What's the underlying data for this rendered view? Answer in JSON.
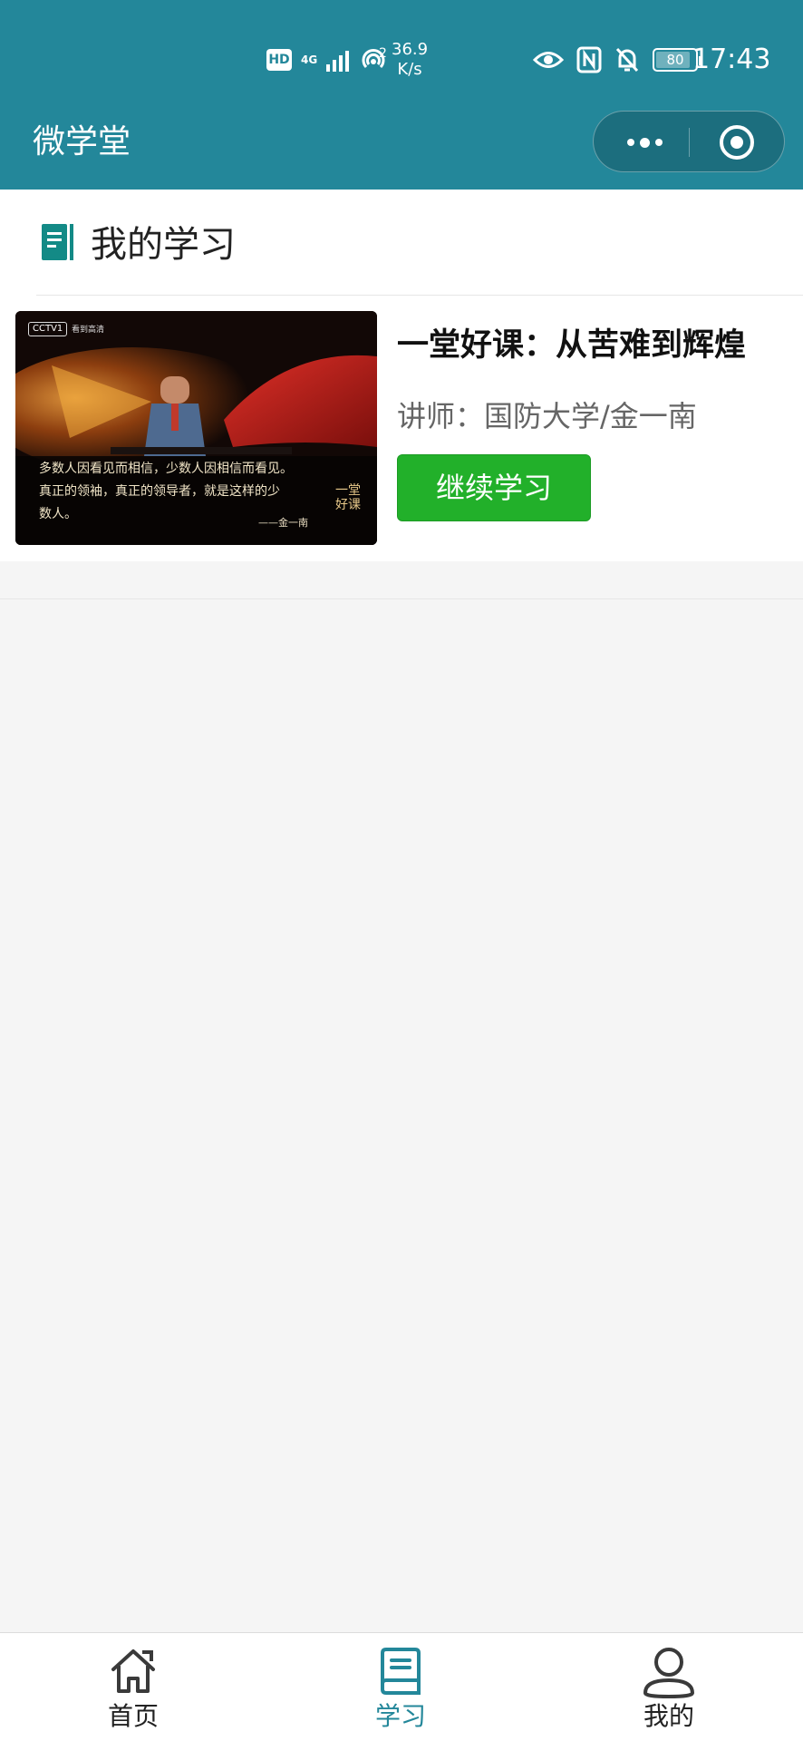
{
  "status_bar": {
    "hd": "HD",
    "network": "4G",
    "hotspot_count": "2",
    "speed_value": "36.9",
    "speed_unit": "K/s",
    "battery": "80",
    "time": "17:43"
  },
  "nav": {
    "title": "微学堂",
    "more_icon": "more-dots-icon",
    "close_icon": "target-circle-icon"
  },
  "section": {
    "title": "我的学习",
    "icon": "book-icon"
  },
  "course": {
    "title": "一堂好课：从苦难到辉煌",
    "teacher": "讲师：国防大学/金一南",
    "button": "继续学习",
    "thumbnail": {
      "logo": "CCTV1",
      "logo_sub": "看到高清",
      "quote_line1": "多数人因看见而相信，少数人因相信而看见。",
      "quote_line2": "真正的领袖，真正的领导者，就是这样的少",
      "quote_line3": "数人。",
      "signature": "——金一南",
      "mark_line1": "一堂",
      "mark_line2": "好课"
    }
  },
  "tabbar": {
    "tabs": [
      {
        "label": "首页",
        "icon": "home-icon",
        "active": false
      },
      {
        "label": "学习",
        "icon": "book-icon",
        "active": true
      },
      {
        "label": "我的",
        "icon": "user-icon",
        "active": false
      }
    ]
  },
  "colors": {
    "header": "#23879a",
    "button": "#22b02a",
    "active_tab": "#23879a"
  }
}
